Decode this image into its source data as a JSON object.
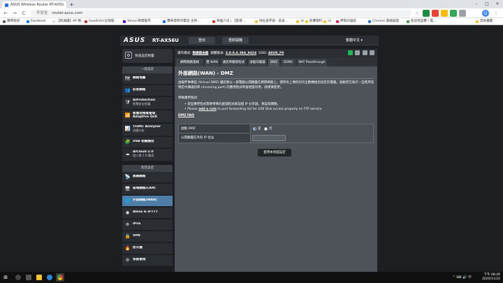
{
  "browser": {
    "tab_title": "ASUS Wireless Router RT-AX5...",
    "tab_close": "×",
    "new_tab": "+",
    "win_min": "–",
    "win_max": "□",
    "win_close": "×",
    "insecure_label": "不安全",
    "url": "router.asus.com",
    "back": "←",
    "forward": "→",
    "reload": "C",
    "star": "☆",
    "profile_initial": "G",
    "menu": "⋮",
    "bookmarks": [
      {
        "label": "應用程式",
        "color": "#5f6368"
      },
      {
        "label": "Facebook",
        "color": "#1877f2"
      },
      {
        "label": "【新通識】AP 微...",
        "color": "#e0e0e0"
      },
      {
        "label": "Goodinfo!台灣股...",
        "color": "#c0392b"
      },
      {
        "label": "Yahoo!奇摩股市",
        "color": "#6001d2"
      },
      {
        "label": "寶華證券的電話-主持...",
        "color": "#1a73e8"
      },
      {
        "label": "華義六法 | 【首選...",
        "color": "#e53935"
      },
      {
        "label": "地址查字號 - 美食...",
        "color": "#fbc02d"
      },
      {
        "label": "3c",
        "color": "#fbc02d"
      },
      {
        "label": "影響資料",
        "color": "#fbc02d"
      },
      {
        "label": "cli",
        "color": "#fbc02d"
      },
      {
        "label": "伊莉討論區",
        "color": "#e91e63"
      },
      {
        "label": "Chrome 遠端桌面",
        "color": "#1a73e8"
      },
      {
        "label": "松鼠控盃賽 | 奧...",
        "color": "#43a047"
      },
      {
        "label": "其他書籤",
        "color": "#fbc02d"
      }
    ]
  },
  "router": {
    "logo": "ASUS",
    "model": "RT-AX56U",
    "logout": "登出",
    "reboot": "重新開機",
    "language": "繁體中文",
    "sidebar": {
      "quick_setup": "快速設定精靈",
      "general_head": "一般設定",
      "general_items": [
        {
          "label": "網路地圖",
          "icon": "🗺"
        },
        {
          "label": "訪客網路",
          "icon": "👥"
        },
        {
          "label": "AiProtection",
          "sub": "智慧安全防護",
          "icon": "🛡"
        },
        {
          "label": "智慧型頻寬管理 Adaptive QoS",
          "sub": "",
          "icon": "📶"
        },
        {
          "label": "Traffic Analyzer",
          "sub": "流量分析",
          "icon": "📊"
        },
        {
          "label": "USB 相關應用",
          "icon": "🧩"
        },
        {
          "label": "AiCloud 2.0",
          "sub": "個人雲 2.0 應用",
          "icon": "☁"
        }
      ],
      "advanced_head": "進階設定",
      "advanced_items": [
        {
          "label": "無線網路",
          "icon": "📡"
        },
        {
          "label": "區域網路(LAN)",
          "icon": "🖥"
        },
        {
          "label": "外部網路(WAN)",
          "icon": "🌐"
        },
        {
          "label": "Alexa & IFTTT",
          "icon": "◉"
        },
        {
          "label": "IPv6",
          "icon": "⊕"
        },
        {
          "label": "VPN",
          "icon": "🔒"
        },
        {
          "label": "防火牆",
          "icon": "🔥"
        },
        {
          "label": "系統管理",
          "icon": "⚙"
        }
      ]
    },
    "status": {
      "mode_label": "運作模式:",
      "mode_value": "無線路由器",
      "fw_label": "韌體版本:",
      "fw_value": "3.0.0.4.384_9424",
      "ssid_label": "SSID:",
      "ssid_value": "ASUS_F0"
    },
    "tabs": [
      "網際網路連線",
      "雙 WAN",
      "通訊埠觸發程式",
      "虛擬伺服器",
      "DMZ",
      "DDNS",
      "NAT Passthrough"
    ],
    "content": {
      "title": "外部網路(WAN) - DMZ",
      "desc": "虛擬伴事專區 (Virtual DMZ) 讓您將以一部電腦公開顯露在網際網路上，使所有上傳的封包全數轉給您指定的電腦。啟動若在執行一些使用非特定內傳通訊埠 (incoming port) 的應用程式時會相當有用，請謹慎使用。",
      "note": "特殊應用程式:",
      "bullet1": "某些應用程式需要特殊的處理程式來穿越 IP 分享器，預設值關閉。",
      "bullet2_pre": "Please",
      "bullet2_link": "add a rule",
      "bullet2_post": "to port forwarding list for USB Disk access properly on FTP service.",
      "faq": "DMZ FAQ",
      "enable_label": "啟動 DMZ",
      "yes": "是",
      "no": "否",
      "ip_label": "公開顯露在外的 IP 位址",
      "ip_value": "",
      "apply": "套用本頁面設定"
    }
  },
  "taskbar": {
    "start": "⊞",
    "time": "下午 08:46",
    "date": "2020/11/22",
    "tray": "^ ⌨ 🔊 中"
  }
}
